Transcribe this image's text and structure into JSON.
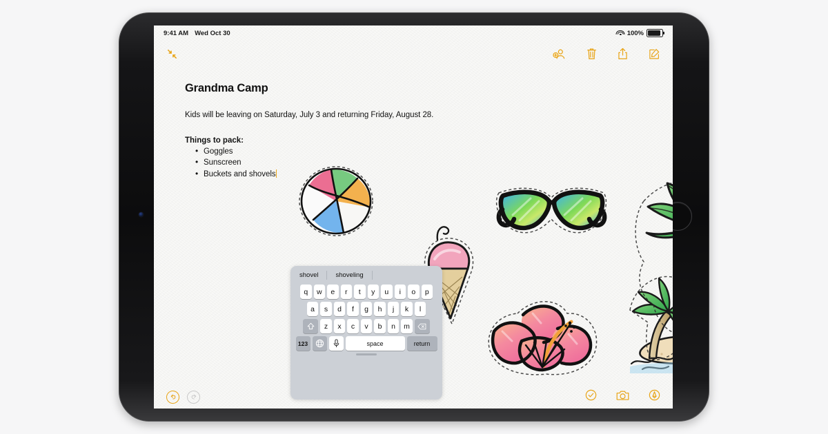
{
  "device": {
    "name": "iPad",
    "orientation": "landscape"
  },
  "statusbar": {
    "time": "9:41 AM",
    "date": "Wed Oct 30",
    "wifi_icon": "wifi-icon",
    "battery_percent": "100%",
    "battery_icon": "battery-full-icon"
  },
  "toolbar": {
    "collapse_icon": "collapse-arrows-icon",
    "items": [
      {
        "icon": "add-collaborator-icon",
        "label": "Collaborate"
      },
      {
        "icon": "trash-icon",
        "label": "Delete"
      },
      {
        "icon": "share-icon",
        "label": "Share"
      },
      {
        "icon": "compose-icon",
        "label": "New Note"
      }
    ]
  },
  "note": {
    "title": "Grandma Camp",
    "paragraph": "Kids will be leaving on Saturday, July 3 and returning Friday, August 28.",
    "subhead": "Things to pack:",
    "list": [
      "Goggles",
      "Sunscreen",
      "Buckets and shovels"
    ],
    "cursor_after": "Buckets and shovels",
    "cursor_color": "#e8a416"
  },
  "stickers": [
    {
      "name": "beach-ball-sticker",
      "label": "Beach ball"
    },
    {
      "name": "ice-cream-cone-sticker",
      "label": "Ice cream cone"
    },
    {
      "name": "sunglasses-sticker",
      "label": "Sunglasses"
    },
    {
      "name": "hibiscus-flower-sticker",
      "label": "Hibiscus flower"
    },
    {
      "name": "palm-tree-island-sticker",
      "label": "Palm tree island"
    }
  ],
  "keyboard": {
    "type": "floating-compact",
    "predictions": [
      "shovel",
      "shoveling"
    ],
    "row1": [
      "q",
      "w",
      "e",
      "r",
      "t",
      "y",
      "u",
      "i",
      "o",
      "p"
    ],
    "row2": [
      "a",
      "s",
      "d",
      "f",
      "g",
      "h",
      "j",
      "k",
      "l"
    ],
    "row3": [
      "z",
      "x",
      "c",
      "v",
      "b",
      "n",
      "m"
    ],
    "shift_icon": "shift-icon",
    "backspace_icon": "backspace-icon",
    "numbers_label": "123",
    "globe_icon": "globe-icon",
    "microphone_icon": "microphone-icon",
    "space_label": "space",
    "return_label": "return",
    "handle_icon": "drag-handle-icon"
  },
  "bottombar": {
    "undo": {
      "icon": "undo-icon",
      "enabled": true,
      "color": "#e8a416"
    },
    "redo": {
      "icon": "redo-icon",
      "enabled": false,
      "color": "#c9c9c9"
    },
    "checklist": {
      "icon": "checklist-icon",
      "color": "#e8a416"
    },
    "camera": {
      "icon": "camera-icon",
      "color": "#e8a416"
    },
    "markup": {
      "icon": "markup-pen-icon",
      "color": "#e8a416"
    }
  },
  "colors": {
    "accent": "#e8a416",
    "page_background": "#f6f6f7",
    "screen_background": "#f7f7f5",
    "keyboard_background": "#ccd0d6"
  }
}
